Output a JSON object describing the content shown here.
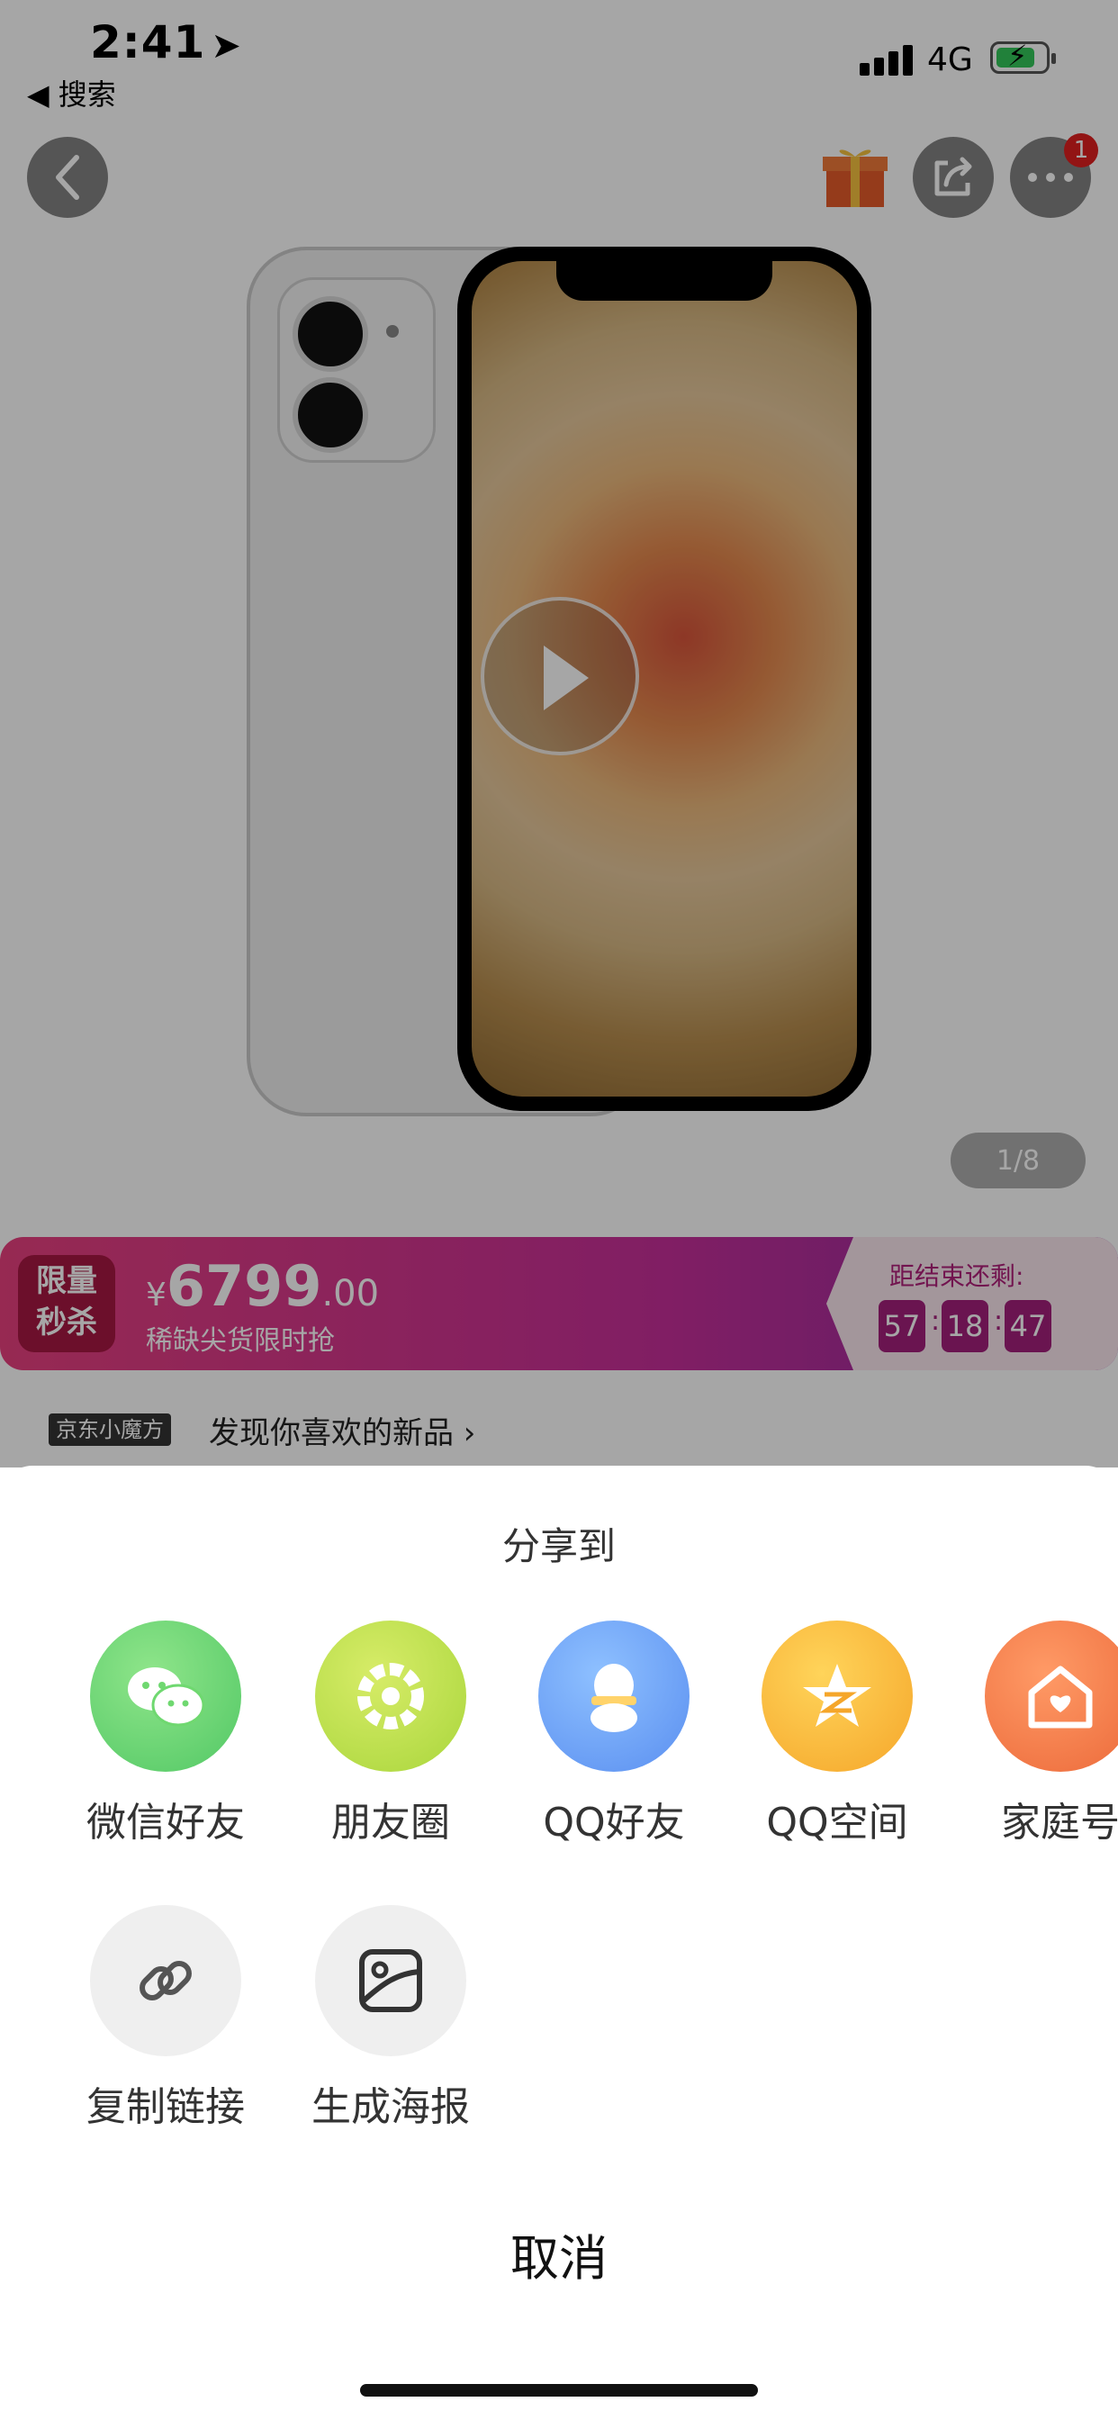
{
  "status_bar": {
    "time": "2:41",
    "back_app": "◀ 搜索",
    "network": "4G"
  },
  "top_bar": {
    "more_badge": "1"
  },
  "gallery": {
    "pager": "1/8"
  },
  "flash_sale": {
    "tag_line1": "限量",
    "tag_line2": "秒杀",
    "currency": "¥",
    "price_int": "6799",
    "price_dec": ".00",
    "subtitle": "稀缺尖货限时抢",
    "countdown_label": "距结束还剩:",
    "hours": "57",
    "minutes": "18",
    "seconds": "47"
  },
  "discovery": {
    "logo": "京东小魔方",
    "text": "发现你喜欢的新品 ›"
  },
  "share_sheet": {
    "title": "分享到",
    "targets": [
      {
        "label": "微信好友",
        "color": "#6fd870"
      },
      {
        "label": "朋友圈",
        "color": "#b9e04e"
      },
      {
        "label": "QQ好友",
        "color": "#6fa3f2"
      },
      {
        "label": "QQ空间",
        "color": "#f8b93a"
      },
      {
        "label": "家庭号",
        "color": "#f07a4a"
      },
      {
        "label": "复制链接",
        "color": "#efefef"
      },
      {
        "label": "生成海报",
        "color": "#efefef"
      }
    ],
    "cancel": "取消"
  }
}
